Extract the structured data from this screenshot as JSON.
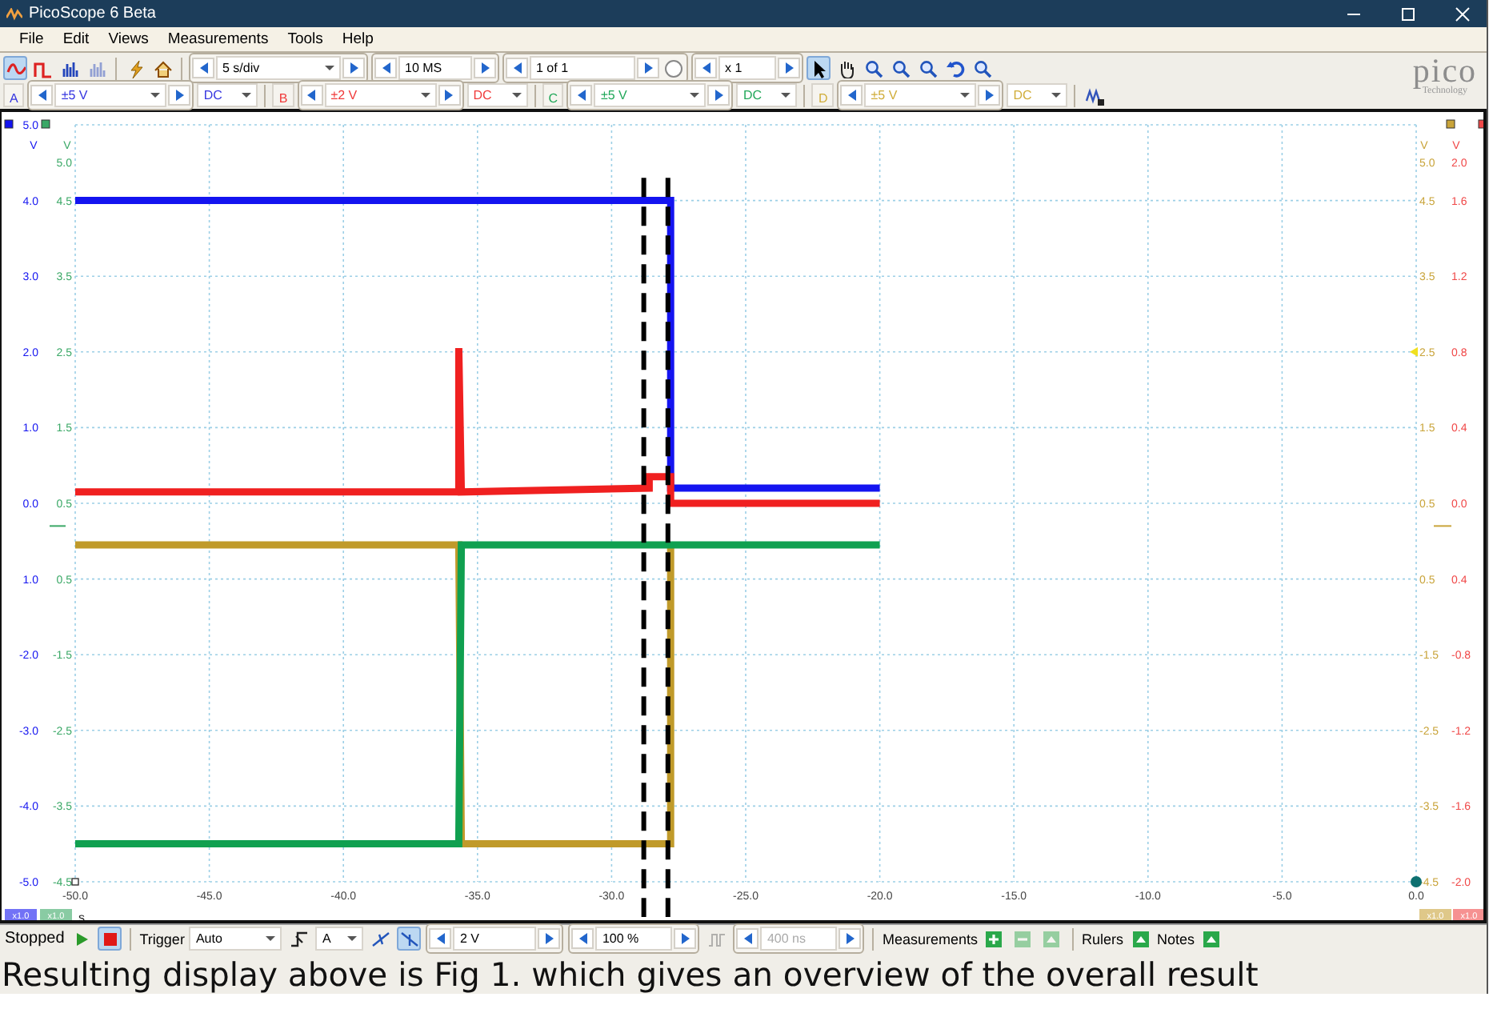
{
  "window": {
    "title": "PicoScope 6 Beta"
  },
  "menu": [
    {
      "label": "File"
    },
    {
      "label": "Edit"
    },
    {
      "label": "Views"
    },
    {
      "label": "Measurements"
    },
    {
      "label": "Tools"
    },
    {
      "label": "Help"
    }
  ],
  "toolbar": {
    "mode_buttons": [
      {
        "kind": "scope",
        "selected": true,
        "disabled": false
      },
      {
        "kind": "persistence",
        "selected": false,
        "disabled": false
      },
      {
        "kind": "spectrum",
        "selected": false,
        "disabled": false
      },
      {
        "kind": "spectrum",
        "selected": false,
        "disabled": true
      }
    ],
    "action_buttons": [
      {
        "kind": "lightning"
      },
      {
        "kind": "home"
      }
    ],
    "timebase": "5 s/div",
    "samples": "10 MS",
    "buffer": "1 of 1",
    "zoom": "x 1",
    "tool_buttons": [
      {
        "kind": "pointer",
        "selected": true
      },
      {
        "kind": "hand",
        "selected": false
      },
      {
        "kind": "zoom",
        "selected": false
      },
      {
        "kind": "zoom",
        "selected": false
      },
      {
        "kind": "zoom",
        "selected": false
      },
      {
        "kind": "undo",
        "selected": false
      },
      {
        "kind": "zoom",
        "selected": false
      }
    ],
    "logo": "pico",
    "logo_subtitle": "Technology"
  },
  "channels": [
    {
      "letter": "A",
      "range": "±5 V",
      "coupling": "DC",
      "color": "#3535e0"
    },
    {
      "letter": "B",
      "range": "±2 V",
      "coupling": "DC",
      "color": "#f03a3a"
    },
    {
      "letter": "C",
      "range": "±5 V",
      "coupling": "DC",
      "color": "#22a85a"
    },
    {
      "letter": "D",
      "range": "±5 V",
      "coupling": "DC",
      "color": "#d0ad3a"
    }
  ],
  "plot": {
    "primary_scale": "x1.0",
    "left_axes": [
      {
        "color": "#3aa866",
        "unit": "V",
        "scale": "x1.0",
        "labels": [
          "5.0",
          "4.5",
          "3.5",
          "2.5",
          "1.5",
          "0.5",
          "0.5",
          "-1.5",
          "-2.5",
          "-3.5",
          "-4.5"
        ]
      }
    ],
    "right_axes": [
      {
        "color": "#c9a43a",
        "unit": "V",
        "scale": "x1.0",
        "labels": [
          "5.0",
          "4.5",
          "3.5",
          "2.5",
          "1.5",
          "0.5",
          "0.5",
          "-1.5",
          "-2.5",
          "-3.5",
          "-4.5"
        ]
      },
      {
        "color": "#f04848",
        "unit": "V",
        "scale": "x1.0",
        "labels": [
          "2.0",
          "1.6",
          "1.2",
          "0.8",
          "0.4",
          "0.0",
          "0.4",
          "-0.8",
          "-1.2",
          "-1.6",
          "-2.0"
        ]
      }
    ],
    "chart_data": {
      "type": "line",
      "xlabel": "s",
      "ylabel": "V",
      "grid": true,
      "x": [
        -50,
        -35.7,
        -35.7,
        -35.6,
        -28.6,
        -28.6,
        -27.8,
        -27.8,
        -20
      ],
      "xlim": [
        -50,
        0
      ],
      "ylim": [
        -5,
        5
      ],
      "xticks": [
        {
          "value": -50,
          "label": "-50.0"
        },
        {
          "value": -45,
          "label": "-45.0"
        },
        {
          "value": -40,
          "label": "-40.0"
        },
        {
          "value": -35,
          "label": "-35.0"
        },
        {
          "value": -30,
          "label": "-30.0"
        },
        {
          "value": -25,
          "label": "-25.0"
        },
        {
          "value": -20,
          "label": "-20.0"
        },
        {
          "value": -15,
          "label": "-15.0"
        },
        {
          "value": -10,
          "label": "-10.0"
        },
        {
          "value": -5,
          "label": "-5.0"
        },
        {
          "value": 0,
          "label": "0.0"
        }
      ],
      "yticks": [
        {
          "value": 5,
          "label": "5.0"
        },
        {
          "value": 4,
          "label": "4.0"
        },
        {
          "value": 3,
          "label": "3.0"
        },
        {
          "value": 2,
          "label": "2.0"
        },
        {
          "value": 1,
          "label": "1.0"
        },
        {
          "value": 0,
          "label": "0.0"
        },
        {
          "value": -1,
          "label": "1.0"
        },
        {
          "value": -2,
          "label": "-2.0"
        },
        {
          "value": -3,
          "label": "-3.0"
        },
        {
          "value": -4,
          "label": "-4.0"
        },
        {
          "value": -5,
          "label": "-5.0"
        }
      ],
      "series": [
        {
          "color": "#1414f0",
          "values": [
            4.0,
            4.0,
            4.0,
            4.0,
            4.0,
            4.0,
            4.0,
            0.2,
            0.2
          ]
        },
        {
          "color": "#f02020",
          "values": [
            0.15,
            0.15,
            2.05,
            0.15,
            0.2,
            0.35,
            0.35,
            0.0,
            0.0
          ]
        },
        {
          "color": "#c09a2a",
          "values": [
            -0.55,
            -0.55,
            -0.55,
            -4.5,
            -4.5,
            -4.5,
            -4.5,
            -0.55,
            null
          ]
        },
        {
          "color": "#10a050",
          "values": [
            -4.5,
            -4.5,
            -4.5,
            -0.55,
            -0.55,
            -0.55,
            -0.55,
            -0.55,
            -0.55
          ]
        }
      ],
      "ref_lines": [
        {
          "axis": "x",
          "value": -28.8
        },
        {
          "axis": "x",
          "value": -27.9
        }
      ]
    }
  },
  "status_bar": {
    "state": "Stopped",
    "run_buttons": [
      {
        "kind": "play",
        "selected": false
      },
      {
        "kind": "stop",
        "selected": true
      }
    ],
    "trigger_label": "Trigger",
    "trigger_mode": "Auto",
    "trigger_channel": "A",
    "edge_buttons": [
      {
        "kind": "rising",
        "selected": false
      },
      {
        "kind": "falling",
        "selected": true
      }
    ],
    "threshold": "2 V",
    "pre_trigger": "100 %",
    "delay": {
      "value": "400 ns",
      "disabled": true
    },
    "measurements": {
      "label": "Measurements",
      "buttons": [
        {
          "kind": "add",
          "disabled": false
        },
        {
          "kind": "remove",
          "disabled": true
        },
        {
          "kind": "edit",
          "disabled": true
        }
      ]
    },
    "rulers": "Rulers",
    "notes": "Notes"
  },
  "caption": "Resulting display above is Fig 1. which gives an overview of the overall result"
}
